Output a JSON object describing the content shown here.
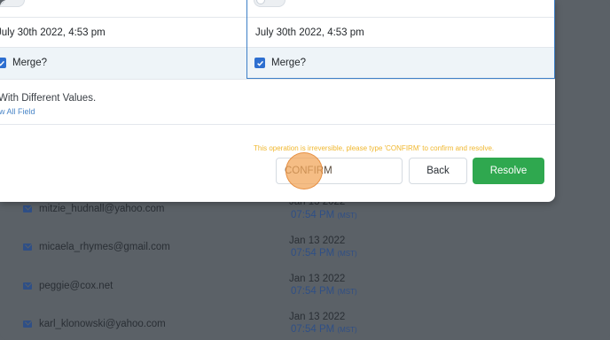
{
  "compare": {
    "left": {
      "date": "July 30th 2022, 4:53 pm",
      "merge_label": "Merge?"
    },
    "right": {
      "date": "July 30th 2022, 4:53 pm",
      "merge_label": "Merge?"
    }
  },
  "diff": {
    "title": "With Different Values.",
    "view_all": "w All Field"
  },
  "confirm": {
    "warning": "This operation is irreversible, please type 'CONFIRM' to confirm and resolve.",
    "input_value": "CONFIRM",
    "back_label": "Back",
    "resolve_label": "Resolve"
  },
  "background_list": [
    {
      "email": "mitzie_hudnall@yahoo.com",
      "date": "Jan 13 2022",
      "time": "07:54 PM",
      "tz": "(MST)"
    },
    {
      "email": "micaela_rhymes@gmail.com",
      "date": "Jan 13 2022",
      "time": "07:54 PM",
      "tz": "(MST)"
    },
    {
      "email": "peggie@cox.net",
      "date": "Jan 13 2022",
      "time": "07:54 PM",
      "tz": "(MST)"
    },
    {
      "email": "karl_klonowski@yahoo.com",
      "date": "Jan 13 2022",
      "time": "07:54 PM",
      "tz": "(MST)"
    }
  ],
  "colors": {
    "overlay": "#5b6167",
    "accent_blue": "#2e6fd0",
    "resolve_green": "#2fa84f",
    "warning_yellow": "#f0b72e"
  }
}
